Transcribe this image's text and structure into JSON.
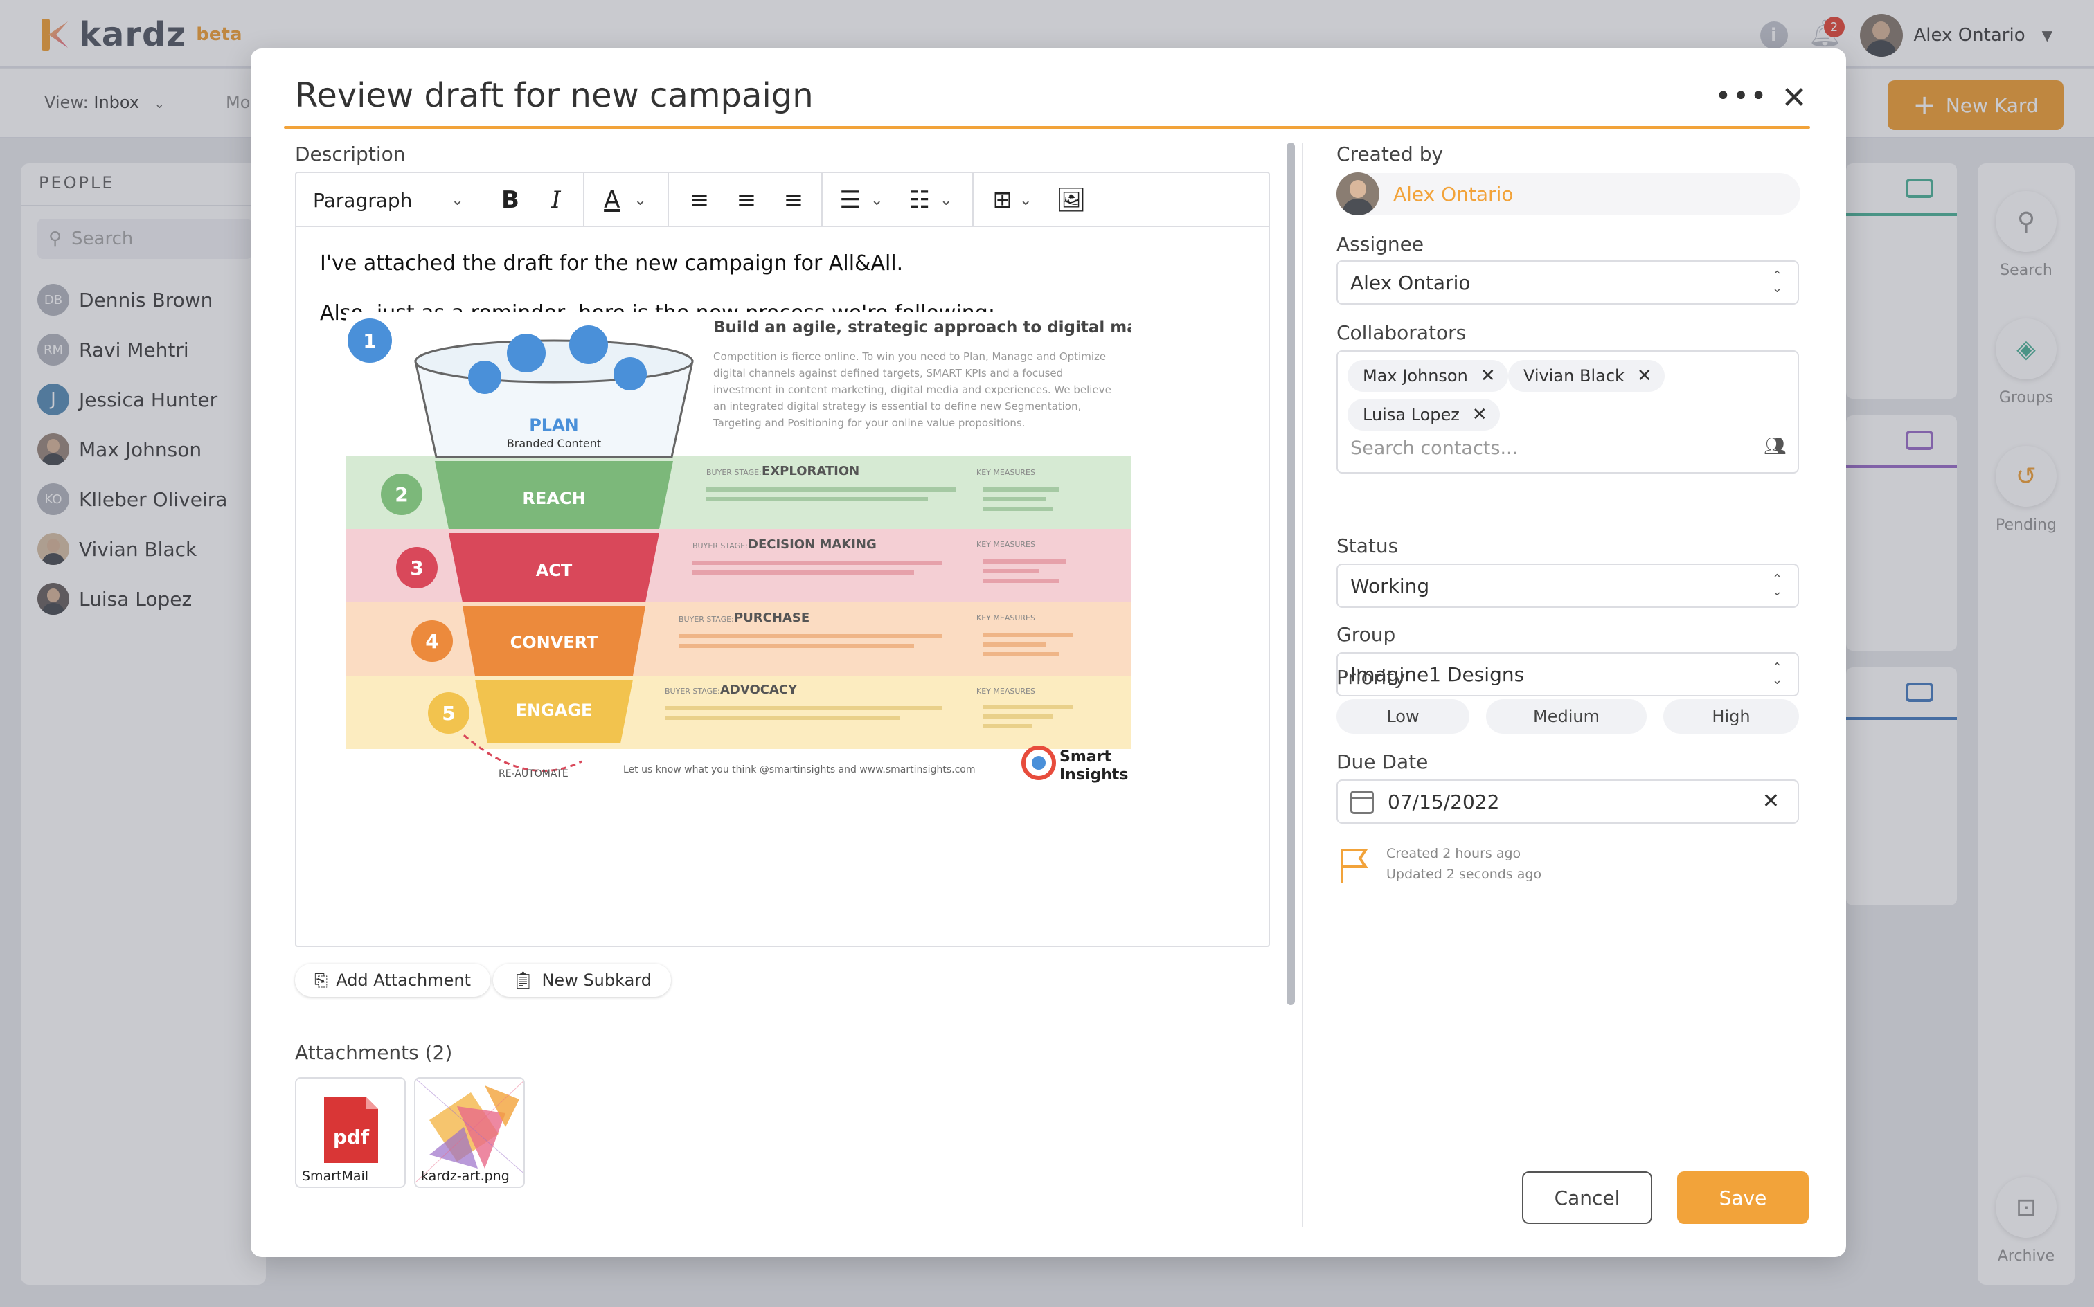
{
  "app": {
    "logo_text": "kardz",
    "logo_badge": "beta",
    "notification_count": "2",
    "user_name": "Alex Ontario",
    "view_label": "View:",
    "view_value": "Inbox",
    "truncated_label": "Mo",
    "new_kard_label": "New Kard",
    "accent_color": "#f2a33a"
  },
  "people": {
    "title": "PEOPLE",
    "search_placeholder": "Search",
    "items": [
      {
        "name": "Dennis Brown",
        "initials": "DB"
      },
      {
        "name": "Ravi Mehtri",
        "initials": "RM"
      },
      {
        "name": "Jessica Hunter",
        "initials": "J"
      },
      {
        "name": "Max Johnson",
        "initials": ""
      },
      {
        "name": "Klleber Oliveira",
        "initials": "KO"
      },
      {
        "name": "Vivian Black",
        "initials": ""
      },
      {
        "name": "Luisa Lopez",
        "initials": ""
      }
    ]
  },
  "rail": {
    "search": "Search",
    "groups": "Groups",
    "pending": "Pending",
    "archive": "Archive"
  },
  "modal": {
    "title": "Review draft for new campaign",
    "description_label": "Description",
    "toolbar": {
      "block_format": "Paragraph",
      "bold": "B",
      "italic": "I",
      "text_color": "A"
    },
    "body": {
      "line1": "I've attached the draft for the new campaign for All&All.",
      "line2": "Also, just as a reminder, here is the new process we're following:"
    },
    "infographic": {
      "title": "Build an agile, strategic approach to digital marketing",
      "intro": [
        "Competition is fierce online. To win you need to Plan, Manage and Optimize",
        "digital channels against defined targets, SMART KPIs and a focused",
        "investment in content marketing, digital media and experiences. We believe",
        "an integrated digital strategy is essential to define new Segmentation,",
        "Targeting and Positioning for your online value propositions."
      ],
      "plan": "PLAN",
      "plan_sub": "Branded Content",
      "stages": [
        {
          "num": "1",
          "name": "",
          "stage": "",
          "color": "#4a90d9"
        },
        {
          "num": "2",
          "name": "REACH",
          "stage": "EXPLORATION",
          "color": "#7cb87a"
        },
        {
          "num": "3",
          "name": "ACT",
          "stage": "DECISION MAKING",
          "color": "#d9485a"
        },
        {
          "num": "4",
          "name": "CONVERT",
          "stage": "PURCHASE",
          "color": "#ec8a3c"
        },
        {
          "num": "5",
          "name": "ENGAGE",
          "stage": "ADVOCACY",
          "color": "#f2c34e"
        }
      ],
      "buyer_stage_label": "BUYER STAGE:",
      "key_measures_label": "KEY MEASURES",
      "reautomate": "RE-AUTOMATE",
      "footer": "Let us know what you think @smartinsights and www.smartinsights.com",
      "brand_line1": "Smart",
      "brand_line2": "Insights"
    },
    "add_attachment_label": "Add Attachment",
    "new_subkard_label": "New Subkard",
    "attachments_label": "Attachments (2)",
    "attachments": [
      {
        "name": "SmartMail",
        "type": "pdf"
      },
      {
        "name": "kardz-art.png",
        "type": "image"
      }
    ],
    "created_by_label": "Created by",
    "created_by": "Alex Ontario",
    "assignee_label": "Assignee",
    "assignee": "Alex Ontario",
    "collaborators_label": "Collaborators",
    "collaborators": [
      "Max Johnson",
      "Vivian Black",
      "Luisa Lopez"
    ],
    "collab_search_placeholder": "Search contacts...",
    "status_label": "Status",
    "status": "Working",
    "group_label": "Group",
    "group": "Imagine1 Designs",
    "priority_label": "Priority",
    "priorities": [
      "Low",
      "Medium",
      "High"
    ],
    "due_date_label": "Due Date",
    "due_date": "07/15/2022",
    "created_meta": "Created 2 hours ago",
    "updated_meta": "Updated 2 seconds ago",
    "cancel_label": "Cancel",
    "save_label": "Save"
  }
}
